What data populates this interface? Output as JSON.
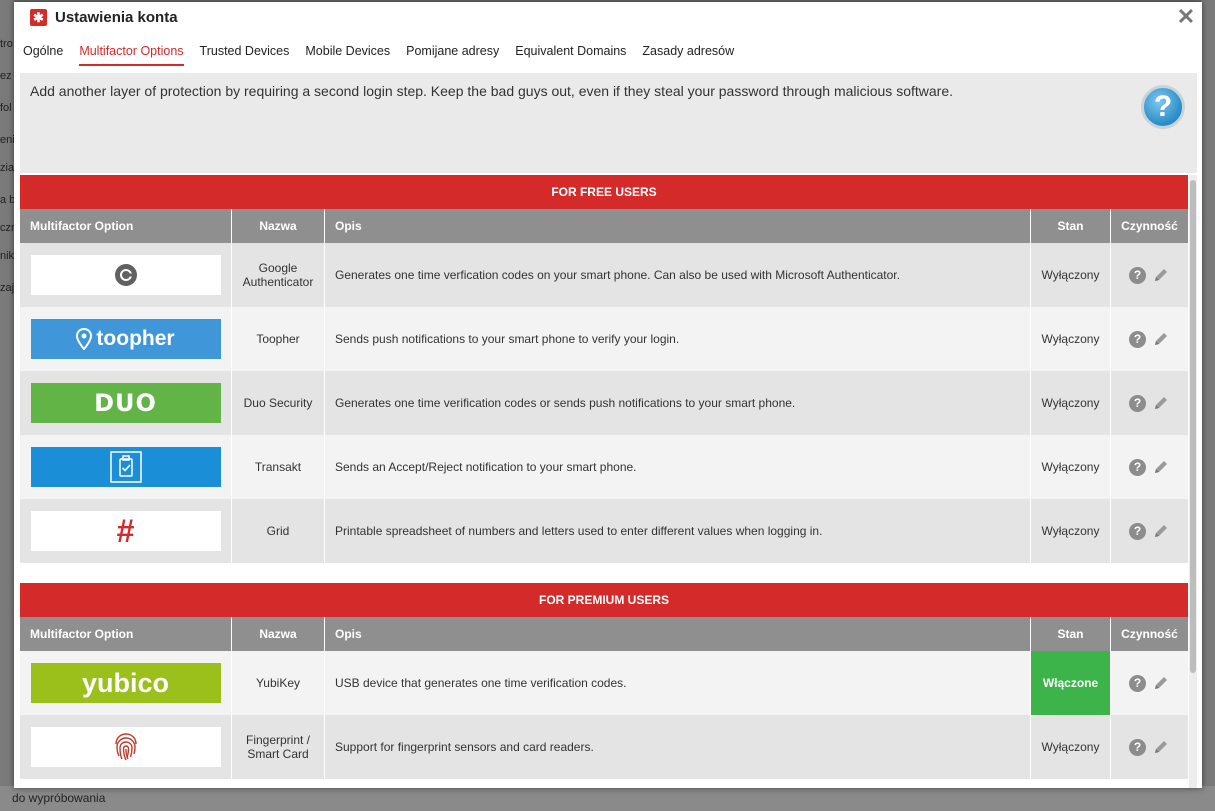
{
  "background": {
    "left_fragments": [
      "tro",
      "ez",
      "fol",
      "eni",
      "zia",
      "a b",
      "czn",
      "nik",
      "zaj"
    ],
    "bottom_text": "do wypróbowania"
  },
  "dialog": {
    "title": "Ustawienia konta",
    "title_icon": "lastpass-asterisk-icon",
    "close_glyph": "✕"
  },
  "tabs": [
    {
      "label": "Ogólne"
    },
    {
      "label": "Multifactor Options",
      "active": true
    },
    {
      "label": "Trusted Devices"
    },
    {
      "label": "Mobile Devices"
    },
    {
      "label": "Pomijane adresy"
    },
    {
      "label": "Equivalent Domains"
    },
    {
      "label": "Zasady adresów"
    }
  ],
  "intro": {
    "text": "Add another layer of protection by requiring a second login step. Keep the bad guys out, even if they steal your password through malicious software.",
    "help_glyph": "?"
  },
  "columns": {
    "option": "Multifactor Option",
    "name": "Nazwa",
    "desc": "Opis",
    "status": "Stan",
    "action": "Czynność"
  },
  "free_section": {
    "heading": "FOR FREE USERS",
    "rows": [
      {
        "logo": "google-authenticator-logo",
        "name": "Google Authenticator",
        "desc": "Generates one time verfication codes on your smart phone. Can also be used with Microsoft Authenticator.",
        "status": "Wyłączony"
      },
      {
        "logo": "toopher-logo",
        "logo_text": "toopher",
        "name": "Toopher",
        "desc": "Sends push notifications to your smart phone to verify your login.",
        "status": "Wyłączony"
      },
      {
        "logo": "duo-logo",
        "logo_text": "DUO",
        "name": "Duo Security",
        "desc": "Generates one time verification codes or sends push notifications to your smart phone.",
        "status": "Wyłączony"
      },
      {
        "logo": "transakt-logo",
        "name": "Transakt",
        "desc": "Sends an Accept/Reject notification to your smart phone.",
        "status": "Wyłączony"
      },
      {
        "logo": "grid-logo",
        "logo_text": "#",
        "name": "Grid",
        "desc": "Printable spreadsheet of numbers and letters used to enter different values when logging in.",
        "status": "Wyłączony"
      }
    ]
  },
  "premium_section": {
    "heading": "FOR PREMIUM USERS",
    "rows": [
      {
        "logo": "yubico-logo",
        "logo_text": "yubico",
        "name": "YubiKey",
        "desc": "USB device that generates one time verification codes.",
        "status": "Włączone",
        "enabled": true
      },
      {
        "logo": "fingerprint-logo",
        "name": "Fingerprint / Smart Card",
        "desc": "Support for fingerprint sensors and card readers.",
        "status": "Wyłączony"
      }
    ]
  },
  "colors": {
    "accent_red": "#d42a2a",
    "enabled_green": "#3cb44a",
    "header_gray": "#8f8f8f",
    "toopher_blue": "#3f97d9",
    "duo_green": "#62b446",
    "transakt_blue": "#1a8fd8",
    "yubico_green": "#9bbf1b"
  }
}
